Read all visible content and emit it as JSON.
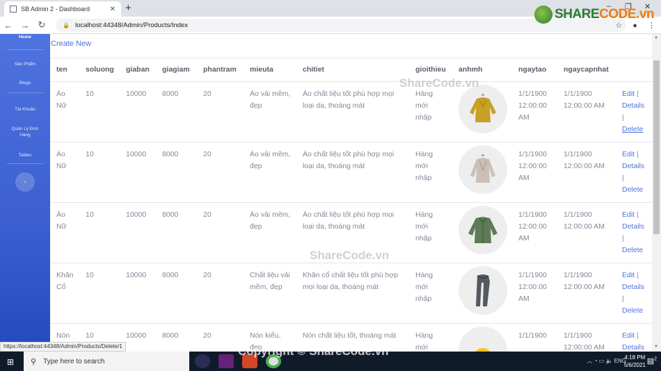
{
  "browser": {
    "tab_title": "SB Admin 2 - Dashboard",
    "tab_close": "✕",
    "new_tab": "+",
    "url": "localhost:44348/Admin/Products/Index",
    "status_url": "https://localhost:44348/Admin/Products/Delete/1",
    "win_min": "–",
    "win_max": "❐",
    "win_close": "✕"
  },
  "logo": {
    "share": "SHARE",
    "code": "CODE",
    "suffix": ".vn"
  },
  "sidebar": {
    "items": [
      {
        "label": "Home"
      },
      {
        "label": "Sản Phẩm"
      },
      {
        "label": "Blogs"
      },
      {
        "label": "Tài Khoản"
      },
      {
        "label": "Quản Lý Đơn Hàng"
      },
      {
        "label": "Tables"
      }
    ],
    "toggle": "‹"
  },
  "page": {
    "create_new": "Create New",
    "columns": [
      "ten",
      "soluong",
      "giaban",
      "giagiam",
      "phantram",
      "mieuta",
      "chitiet",
      "gioithieu",
      "anhmh",
      "ngaytao",
      "ngaycapnhat"
    ],
    "action_edit": "Edit",
    "action_details": "Details",
    "action_delete": "Delete",
    "sep": "|",
    "rows": [
      {
        "ten": "Áo Nữ",
        "soluong": "10",
        "giaban": "10000",
        "giagiam": "8000",
        "phantram": "20",
        "mieuta": "Áo vải mềm, đẹp",
        "chitiet": "Áo chất liệu tốt phù hợp mọi loại da, thoáng mát",
        "gioithieu": "Hàng mới nhập",
        "ngaytao": "1/1/1900 12:00:00 AM",
        "ngaycapnhat": "1/1/1900 12:00:00 AM",
        "image": "mustard-sweater"
      },
      {
        "ten": "Áo Nữ",
        "soluong": "10",
        "giaban": "10000",
        "giagiam": "8000",
        "phantram": "20",
        "mieuta": "Áo vải mềm, đẹp",
        "chitiet": "Áo chất liệu tốt phù hợp mọi loại da, thoáng mát",
        "gioithieu": "Hàng mới nhập",
        "ngaytao": "1/1/1900 12:00:00 AM",
        "ngaycapnhat": "1/1/1900 12:00:00 AM",
        "image": "beige-sweater"
      },
      {
        "ten": "Áo Nữ",
        "soluong": "10",
        "giaban": "10000",
        "giagiam": "8000",
        "phantram": "20",
        "mieuta": "Áo vải mềm, đẹp",
        "chitiet": "Áo chất liệu tốt phù hợp mọi loại da, thoáng mát",
        "gioithieu": "Hàng mới nhập",
        "ngaytao": "1/1/1900 12:00:00 AM",
        "ngaycapnhat": "1/1/1900 12:00:00 AM",
        "image": "green-jacket"
      },
      {
        "ten": "Khăn Cổ",
        "soluong": "10",
        "giaban": "10000",
        "giagiam": "8000",
        "phantram": "20",
        "mieuta": "Chất liệu vải mềm, đẹp",
        "chitiet": "Khăn cổ chất liệu tốt phù hợp mọi loại da, thoáng mát",
        "gioithieu": "Hàng mới nhập",
        "ngaytao": "1/1/1900 12:00:00 AM",
        "ngaycapnhat": "1/1/1900 12:00:00 AM",
        "image": "grey-scarf"
      },
      {
        "ten": "Nón",
        "soluong": "10",
        "giaban": "10000",
        "giagiam": "8000",
        "phantram": "20",
        "mieuta": "Nón kiểu, đẹp",
        "chitiet": "Nón chất liệu tốt, thoáng mát",
        "gioithieu": "Hàng mới",
        "ngaytao": "1/1/1900",
        "ngaycapnhat": "1/1/1900 12:00:00 AM",
        "image": "yellow-hat"
      }
    ]
  },
  "watermarks": [
    "ShareCode.vn",
    "ShareCode.vn",
    "Copyright © ShareCode.vn"
  ],
  "taskbar": {
    "search_placeholder": "Type here to search",
    "language": "ENG",
    "time": "4:18 PM",
    "date": "5/6/2021",
    "notif_count": "2"
  },
  "colors": {
    "primary": "#4e73df",
    "sidebar_dark": "#224abe",
    "text": "#858796",
    "heading": "#5a5c69"
  }
}
